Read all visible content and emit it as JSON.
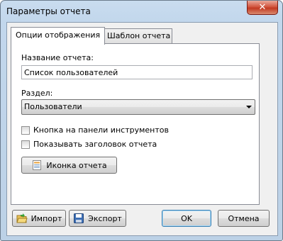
{
  "window": {
    "title": "Параметры отчета",
    "close_symbol": "✕"
  },
  "tabs": [
    {
      "label": "Опции отображения",
      "active": true
    },
    {
      "label": "Шаблон отчета",
      "active": false
    }
  ],
  "form": {
    "name_label": "Название отчета:",
    "name_value": "Список пользователей",
    "section_label": "Раздел:",
    "section_value": "Пользователи",
    "checkboxes": [
      {
        "label": "Кнопка на панели инструментов",
        "checked": false
      },
      {
        "label": "Показывать заголовок отчета",
        "checked": false
      }
    ],
    "icon_button_label": "Иконка отчета"
  },
  "footer": {
    "import_label": "Импорт",
    "export_label": "Экспорт",
    "ok_label": "OK",
    "cancel_label": "Отмена"
  },
  "colors": {
    "accent": "#3c7fb1",
    "close": "#c23a22"
  }
}
